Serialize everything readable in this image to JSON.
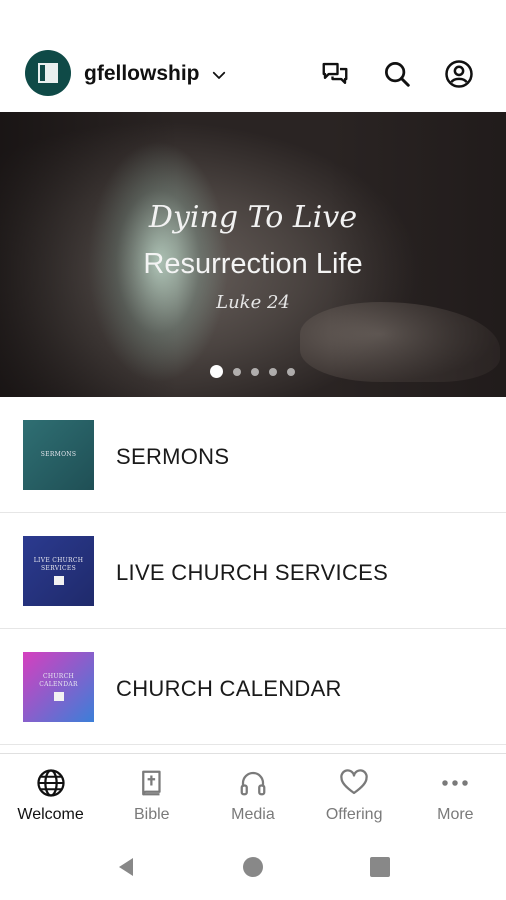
{
  "header": {
    "app_name": "gfellowship",
    "icons": [
      "chevron-down-icon",
      "chat-icon",
      "search-icon",
      "account-icon"
    ]
  },
  "hero": {
    "title": "Dying To Live",
    "subtitle": "Resurrection Life",
    "reference": "Luke 24",
    "slide_count": 5,
    "active_slide": 1
  },
  "list": {
    "items": [
      {
        "label": "SERMONS",
        "thumb_text": "SERMONS",
        "thumb_colors": [
          "#2f6f73",
          "#1f4f55"
        ]
      },
      {
        "label": "LIVE CHURCH SERVICES",
        "thumb_text": "LIVE CHURCH SERVICES",
        "thumb_colors": [
          "#2b3a8f",
          "#1f2a6b"
        ]
      },
      {
        "label": "CHURCH CALENDAR",
        "thumb_text": "CHURCH CALENDAR",
        "thumb_colors": [
          "#d63fbf",
          "#3b7fd8"
        ]
      }
    ]
  },
  "bottom_nav": {
    "items": [
      {
        "label": "Welcome",
        "icon": "globe-icon",
        "active": true
      },
      {
        "label": "Bible",
        "icon": "bible-icon",
        "active": false
      },
      {
        "label": "Media",
        "icon": "headphones-icon",
        "active": false
      },
      {
        "label": "Offering",
        "icon": "heart-icon",
        "active": false
      },
      {
        "label": "More",
        "icon": "more-dots-icon",
        "active": false
      }
    ]
  },
  "colors": {
    "brand": "#0f4a47",
    "active_nav": "#111111",
    "inactive_nav": "#7a7a7a"
  }
}
